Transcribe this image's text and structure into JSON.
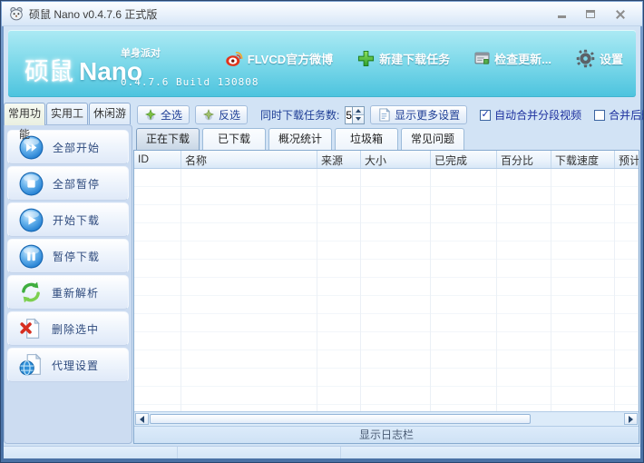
{
  "window": {
    "title": "硕鼠 Nano v0.4.7.6 正式版"
  },
  "banner": {
    "logo_cn": "硕鼠",
    "logo_en": "Nano",
    "tagline": "单身派对",
    "version": "0.4.7.6  Build 130808",
    "links": [
      {
        "label": "FLVCD官方微博",
        "icon": "weibo-icon"
      },
      {
        "label": "新建下载任务",
        "icon": "plus-icon"
      },
      {
        "label": "检查更新...",
        "icon": "update-icon"
      },
      {
        "label": "设置",
        "icon": "gear-icon"
      }
    ]
  },
  "toolbar": {
    "select_all": "全选",
    "invert": "反选",
    "concurrent_label": "同时下载任务数:",
    "concurrent_value": "5",
    "more_settings": "显示更多设置",
    "auto_merge_label": "自动合并分段视频",
    "auto_merge_checked": true,
    "delete_source_label": "合并后删除源文件",
    "delete_source_checked": false
  },
  "sidebar": {
    "tabs": [
      {
        "label": "常用功能",
        "active": true
      },
      {
        "label": "实用工具",
        "active": false
      },
      {
        "label": "休闲游戏",
        "active": false
      }
    ],
    "buttons": [
      {
        "label": "全部开始",
        "icon": "start-all-icon"
      },
      {
        "label": "全部暂停",
        "icon": "stop-all-icon"
      },
      {
        "label": "开始下载",
        "icon": "start-download-icon"
      },
      {
        "label": "暂停下载",
        "icon": "pause-download-icon"
      },
      {
        "label": "重新解析",
        "icon": "reparse-icon"
      },
      {
        "label": "删除选中",
        "icon": "delete-selected-icon"
      },
      {
        "label": "代理设置",
        "icon": "proxy-settings-icon"
      }
    ]
  },
  "main": {
    "tabs": [
      {
        "label": "正在下载",
        "active": true
      },
      {
        "label": "已下载",
        "active": false
      },
      {
        "label": "概况统计",
        "active": false
      },
      {
        "label": "垃圾箱",
        "active": false
      },
      {
        "label": "常见问题",
        "active": false
      }
    ],
    "columns": [
      {
        "label": "ID"
      },
      {
        "label": "名称"
      },
      {
        "label": "来源"
      },
      {
        "label": "大小"
      },
      {
        "label": "已完成"
      },
      {
        "label": "百分比"
      },
      {
        "label": "下载速度"
      },
      {
        "label": "预计剩余"
      }
    ],
    "rows": [],
    "log_toggle_label": "显示日志栏"
  },
  "colors": {
    "banner_top": "#aceaf4",
    "banner_bottom": "#4cc3de",
    "frame_blue": "#4a72a5",
    "accent_navy": "#1f3f96"
  }
}
